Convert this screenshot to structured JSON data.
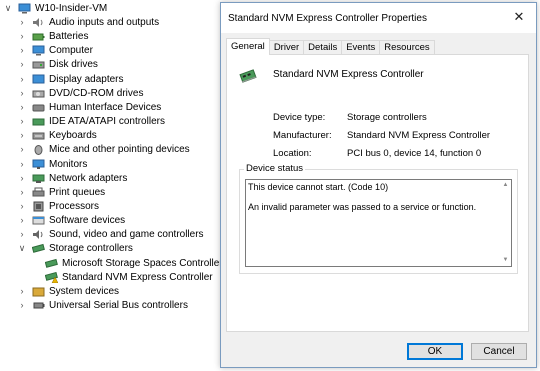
{
  "tree": {
    "root": "W10-Insider-VM",
    "items": [
      {
        "label": "Audio inputs and outputs",
        "icon": "audio-icon",
        "expanded": false
      },
      {
        "label": "Batteries",
        "icon": "battery-icon",
        "expanded": false
      },
      {
        "label": "Computer",
        "icon": "computer-icon",
        "expanded": false
      },
      {
        "label": "Disk drives",
        "icon": "disk-drive-icon",
        "expanded": false
      },
      {
        "label": "Display adapters",
        "icon": "display-adapter-icon",
        "expanded": false
      },
      {
        "label": "DVD/CD-ROM drives",
        "icon": "dvd-icon",
        "expanded": false
      },
      {
        "label": "Human Interface Devices",
        "icon": "hid-icon",
        "expanded": false
      },
      {
        "label": "IDE ATA/ATAPI controllers",
        "icon": "ide-icon",
        "expanded": false
      },
      {
        "label": "Keyboards",
        "icon": "keyboard-icon",
        "expanded": false
      },
      {
        "label": "Mice and other pointing devices",
        "icon": "mouse-icon",
        "expanded": false
      },
      {
        "label": "Monitors",
        "icon": "monitor-icon",
        "expanded": false
      },
      {
        "label": "Network adapters",
        "icon": "network-icon",
        "expanded": false
      },
      {
        "label": "Print queues",
        "icon": "printer-icon",
        "expanded": false
      },
      {
        "label": "Processors",
        "icon": "processor-icon",
        "expanded": false
      },
      {
        "label": "Software devices",
        "icon": "software-device-icon",
        "expanded": false
      },
      {
        "label": "Sound, video and game controllers",
        "icon": "sound-icon",
        "expanded": false
      },
      {
        "label": "Storage controllers",
        "icon": "storage-controller-icon",
        "expanded": true,
        "children": [
          {
            "label": "Microsoft Storage Spaces Controller",
            "icon": "storage-controller-icon",
            "warning": false
          },
          {
            "label": "Standard NVM Express Controller",
            "icon": "storage-controller-warning-icon",
            "warning": true
          }
        ]
      },
      {
        "label": "System devices",
        "icon": "system-device-icon",
        "expanded": false
      },
      {
        "label": "Universal Serial Bus controllers",
        "icon": "usb-icon",
        "expanded": false
      }
    ]
  },
  "dialog": {
    "title": "Standard NVM Express Controller Properties",
    "tabs": [
      "General",
      "Driver",
      "Details",
      "Events",
      "Resources"
    ],
    "active_tab": "General",
    "device_name": "Standard NVM Express Controller",
    "properties": [
      {
        "label": "Device type:",
        "value": "Storage controllers"
      },
      {
        "label": "Manufacturer:",
        "value": "Standard NVM Express Controller"
      },
      {
        "label": "Location:",
        "value": "PCI bus 0, device 14, function 0"
      }
    ],
    "status_label": "Device status",
    "status_line1": "This device cannot start. (Code 10)",
    "status_line2": "An invalid parameter was passed to a service or function.",
    "ok_label": "OK",
    "cancel_label": "Cancel"
  },
  "colors": {
    "folder": "#d9a93a",
    "accent": "#0078d7",
    "warning": "#e8b400"
  }
}
